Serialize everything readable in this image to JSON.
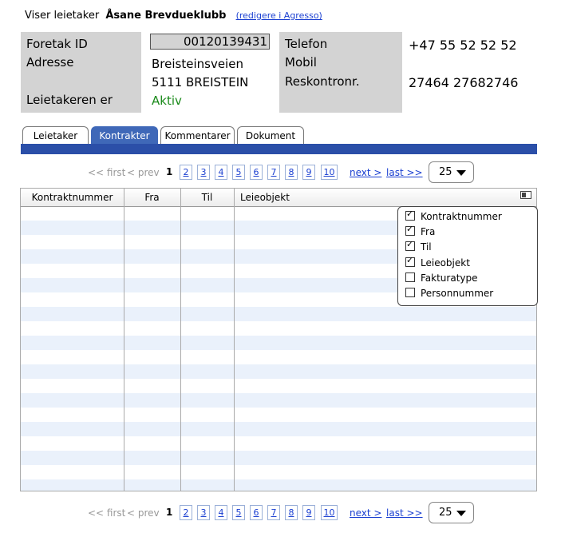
{
  "header": {
    "prefix": "Viser leietaker",
    "tenant_name": "Åsane Brevdueklubb",
    "edit_link": "(redigere i Agresso)"
  },
  "info": {
    "foretak_label": "Foretak ID",
    "foretak_value": "00120139431",
    "adresse_label": "Adresse",
    "adresse_line1": "Breisteinsveien",
    "adresse_line2": "5111 BREISTEIN",
    "status_label": "Leietakeren er",
    "status_value": "Aktiv",
    "telefon_label": "Telefon",
    "telefon_value": "+47 55 52 52 52",
    "mobil_label": "Mobil",
    "reskontro_label": "Reskontronr.",
    "reskontro_value": "27464 27682746"
  },
  "tabs": {
    "leietaker": "Leietaker",
    "kontrakter": "Kontrakter",
    "kommentarer": "Kommentarer",
    "dokument": "Dokument"
  },
  "pager": {
    "first": "<< first",
    "prev": "< prev",
    "current": "1",
    "pages": [
      "2",
      "3",
      "4",
      "5",
      "6",
      "7",
      "8",
      "9",
      "10"
    ],
    "next": "next >",
    "last": "last >>",
    "page_size": "25"
  },
  "table": {
    "columns": [
      "Kontraktnummer",
      "Fra",
      "Til",
      "Leieobjekt"
    ]
  },
  "column_chooser": {
    "options": [
      {
        "label": "Kontraktnummer",
        "checked": true
      },
      {
        "label": "Fra",
        "checked": true
      },
      {
        "label": "Til",
        "checked": true
      },
      {
        "label": "Leieobjekt",
        "checked": true
      },
      {
        "label": "Fakturatype",
        "checked": false
      },
      {
        "label": "Personnummer",
        "checked": false
      }
    ]
  }
}
